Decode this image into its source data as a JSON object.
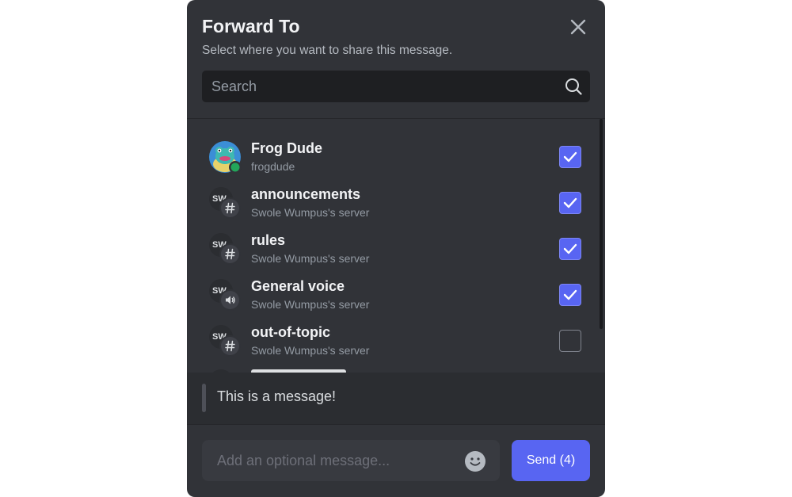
{
  "dialog": {
    "title": "Forward To",
    "subtitle": "Select where you want to share this message."
  },
  "search": {
    "placeholder": "Search"
  },
  "destinations": [
    {
      "name": "Frog Dude",
      "sub": "frogdude",
      "kind": "user",
      "status": "online",
      "checked": true
    },
    {
      "name": "announcements",
      "sub": "Swole Wumpus's server",
      "kind": "text-channel",
      "server_abbr": "SW",
      "checked": true
    },
    {
      "name": "rules",
      "sub": "Swole Wumpus's server",
      "kind": "text-channel",
      "server_abbr": "SW",
      "checked": true
    },
    {
      "name": "General voice",
      "sub": "Swole Wumpus's server",
      "kind": "voice-channel",
      "server_abbr": "SW",
      "checked": true
    },
    {
      "name": "out-of-topic",
      "sub": "Swole Wumpus's server",
      "kind": "text-channel",
      "server_abbr": "SW",
      "checked": false
    }
  ],
  "preview": {
    "message": "This is a message!"
  },
  "composer": {
    "placeholder": "Add an optional message...",
    "send_label": "Send (4)"
  },
  "colors": {
    "accent": "#5865f2",
    "background": "#313338",
    "online": "#23a55a"
  }
}
